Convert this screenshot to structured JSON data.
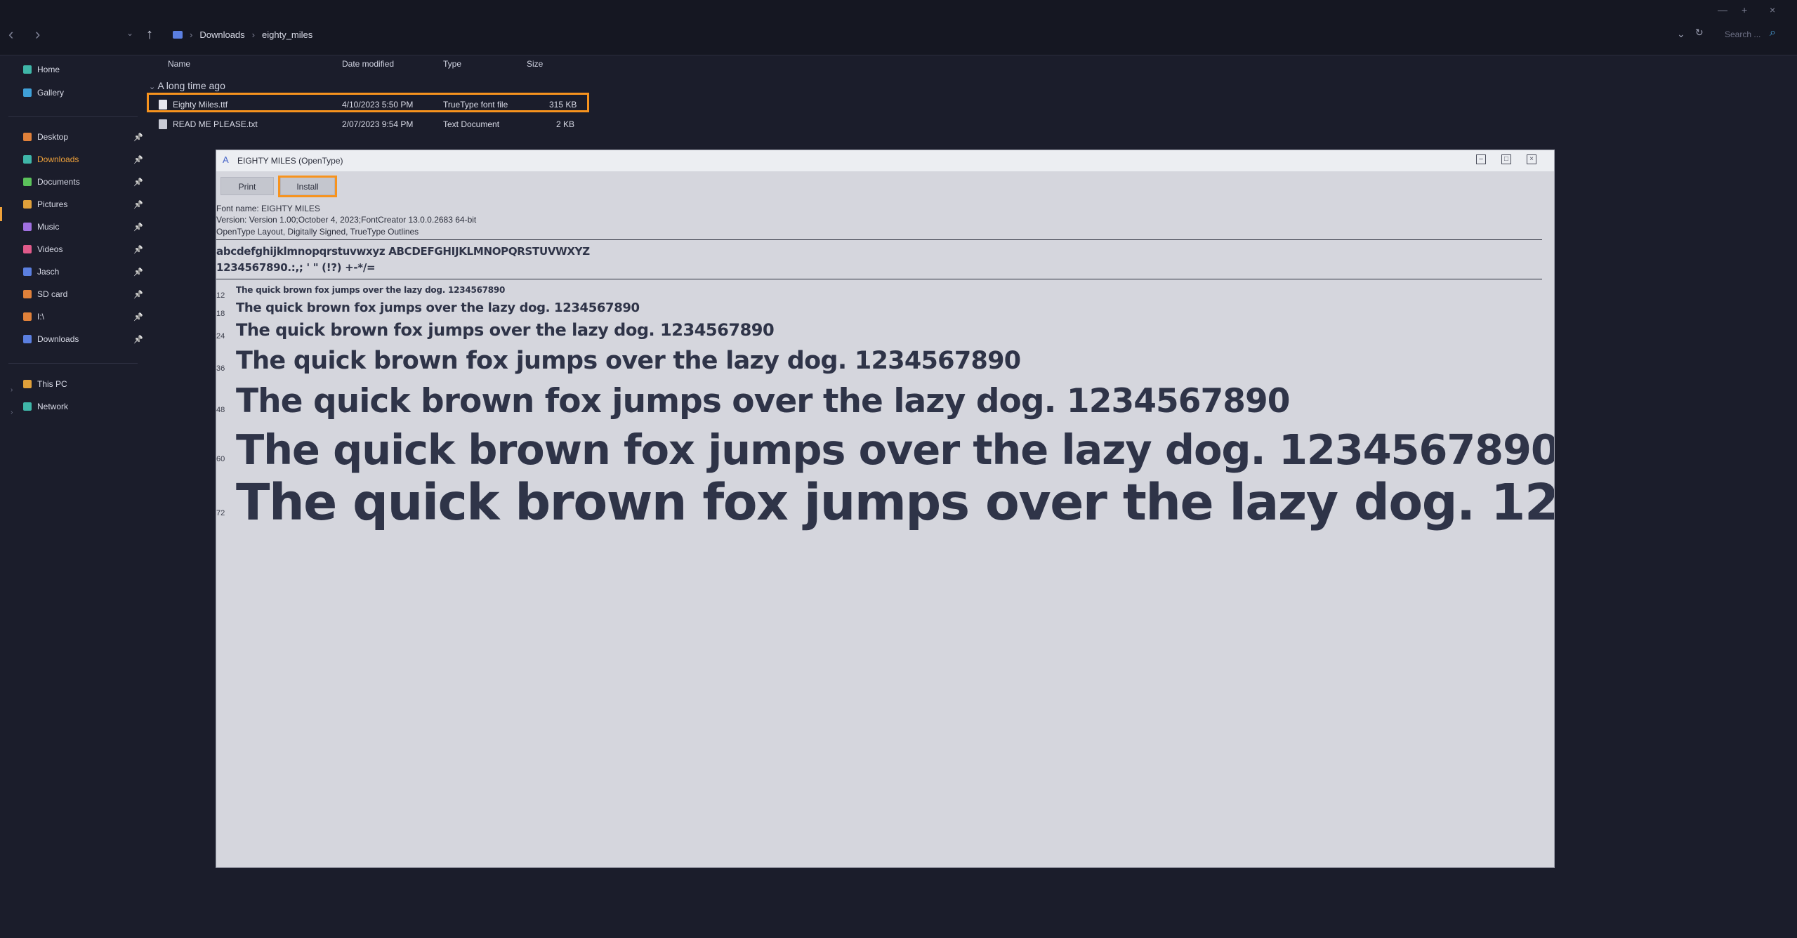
{
  "explorer": {
    "breadcrumb": [
      "Downloads",
      "eighty_miles"
    ],
    "search_placeholder": "Search ...",
    "columns": [
      "Name",
      "Date modified",
      "Type",
      "Size"
    ],
    "group_label": "A long time ago",
    "files": [
      {
        "name": "Eighty Miles.ttf",
        "date": "4/10/2023 5:50 PM",
        "type": "TrueType font file",
        "size": "315 KB"
      },
      {
        "name": "READ ME PLEASE.txt",
        "date": "2/07/2023 9:54 PM",
        "type": "Text Document",
        "size": "2 KB"
      }
    ]
  },
  "sidebar": {
    "items": [
      {
        "label": "Home",
        "icon": "home-icon",
        "color": "#3fb6a8"
      },
      {
        "label": "Gallery",
        "icon": "gallery-icon",
        "color": "#3fa0d8"
      },
      {
        "label": "Desktop",
        "icon": "desktop-icon",
        "color": "#e0813a"
      },
      {
        "label": "Downloads",
        "icon": "downloads-icon",
        "color": "#3fb6a8"
      },
      {
        "label": "Documents",
        "icon": "documents-icon",
        "color": "#5bc25b"
      },
      {
        "label": "Pictures",
        "icon": "pictures-icon",
        "color": "#e0a03a"
      },
      {
        "label": "Music",
        "icon": "music-icon",
        "color": "#a070e0"
      },
      {
        "label": "Videos",
        "icon": "videos-icon",
        "color": "#e05a8a"
      },
      {
        "label": "Jasch",
        "icon": "folder-icon",
        "color": "#5b7fe0"
      },
      {
        "label": "SD card",
        "icon": "sd-card-icon",
        "color": "#e0813a"
      },
      {
        "label": "I:\\",
        "icon": "drive-icon",
        "color": "#e0813a"
      },
      {
        "label": "Downloads",
        "icon": "folder-icon",
        "color": "#5b7fe0"
      },
      {
        "label": "This PC",
        "icon": "this-pc-icon",
        "color": "#e0a03a"
      },
      {
        "label": "Network",
        "icon": "network-icon",
        "color": "#3fb6a8"
      }
    ]
  },
  "viewer": {
    "title": "EIGHTY MILES (OpenType)",
    "print_label": "Print",
    "install_label": "Install",
    "font_name": "Font name: EIGHTY MILES",
    "version": "Version: Version 1.00;October 4, 2023;FontCreator 13.0.0.2683 64-bit",
    "features": "OpenType Layout, Digitally Signed, TrueType Outlines",
    "charset_line1": "abcdefghijklmnopqrstuvwxyz ABCDEFGHIJKLMNOPQRSTUVWXYZ",
    "charset_line2": "1234567890.:,; ' \" (!?) +-*/=",
    "sample_text": "The quick brown fox jumps over the lazy dog. 1234567890",
    "sizes": [
      "12",
      "18",
      "24",
      "36",
      "48",
      "60",
      "72"
    ]
  }
}
